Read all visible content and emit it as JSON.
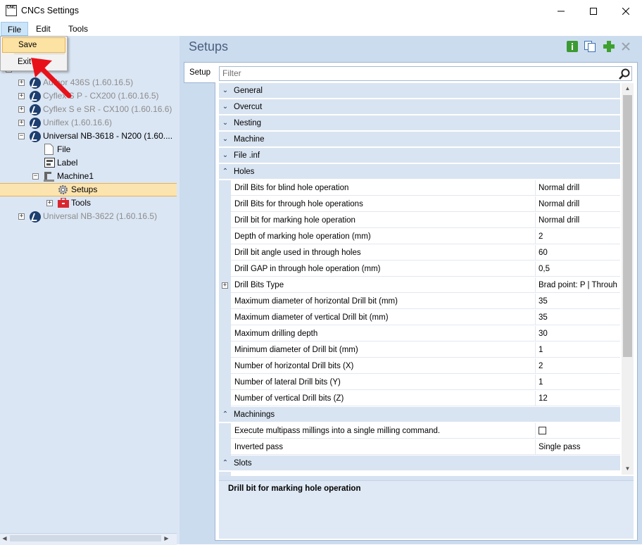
{
  "window": {
    "title": "CNCs Settings",
    "icon_label": "CNC",
    "controls": [
      "minimize-icon",
      "maximize-icon",
      "close-icon"
    ]
  },
  "menubar": {
    "items": [
      "File",
      "Edit",
      "Tools"
    ]
  },
  "file_menu": {
    "items": [
      "Save",
      "Exit"
    ]
  },
  "tree": {
    "items": [
      {
        "label": "Author 436S (1.60.16.5)",
        "disabled": true
      },
      {
        "label": "Cyflex S P - CX200 (1.60.16.5)",
        "disabled": true
      },
      {
        "label": "Cyflex S e SR - CX100 (1.60.16.6)",
        "disabled": true
      },
      {
        "label": "Uniflex (1.60.16.6)",
        "disabled": true
      },
      {
        "label": "Universal NB-3618 - N200 (1.60....",
        "disabled": false
      },
      {
        "label": "File",
        "disabled": false
      },
      {
        "label": "Label",
        "disabled": false
      },
      {
        "label": "Machine1",
        "disabled": false
      },
      {
        "label": "Setups",
        "disabled": false,
        "selected": true
      },
      {
        "label": "Tools",
        "disabled": false
      },
      {
        "label": "Universal NB-3622 (1.60.16.5)",
        "disabled": true
      }
    ]
  },
  "main": {
    "title": "Setups",
    "toolbar_icons": [
      "info-icon",
      "copy-icon",
      "add-icon",
      "delete-icon"
    ],
    "tab": "Setup",
    "filter_placeholder": "Filter"
  },
  "grid": {
    "categories_collapsed": [
      "General",
      "Overcut",
      "Nesting",
      "Machine",
      "File .inf"
    ],
    "holes": {
      "label": "Holes",
      "rows": [
        {
          "name": "Drill Bits for blind hole operation",
          "value": "Normal drill"
        },
        {
          "name": "Drill Bits for through hole operations",
          "value": "Normal drill"
        },
        {
          "name": "Drill bit for marking hole operation",
          "value": "Normal drill"
        },
        {
          "name": "Depth of marking hole operation (mm)",
          "value": "2"
        },
        {
          "name": "Drill bit angle used in through holes",
          "value": "60"
        },
        {
          "name": "Drill GAP in through hole operation (mm)",
          "value": "0,5"
        },
        {
          "name": "Drill Bits Type",
          "value": "Brad point: P  |  Throuh",
          "expandable": true
        },
        {
          "name": "Maximum diameter of horizontal Drill bit (mm)",
          "value": "35"
        },
        {
          "name": "Maximum diameter of vertical Drill bit (mm)",
          "value": "35"
        },
        {
          "name": "Maximum drilling depth",
          "value": "30"
        },
        {
          "name": "Minimum diameter of Drill bit (mm)",
          "value": "1"
        },
        {
          "name": "Number of horizontal Drill bits (X)",
          "value": "2"
        },
        {
          "name": "Number of lateral Drill bits (Y)",
          "value": "1"
        },
        {
          "name": "Number of vertical Drill bits (Z)",
          "value": "12"
        }
      ]
    },
    "machinings": {
      "label": "Machinings",
      "rows": [
        {
          "name": "Execute multipass millings into a single milling command.",
          "value": "",
          "checkbox": true,
          "checked": false
        },
        {
          "name": "Inverted pass",
          "value": "Single pass"
        }
      ]
    },
    "slots": {
      "label": "Slots"
    }
  },
  "description": {
    "text": "Drill bit for marking hole operation"
  },
  "colors": {
    "accent_arrow": "#e8111a",
    "selection": "#fce4b0",
    "category_bg": "#d9e4f2",
    "pane_bg": "#dbe6f4"
  }
}
